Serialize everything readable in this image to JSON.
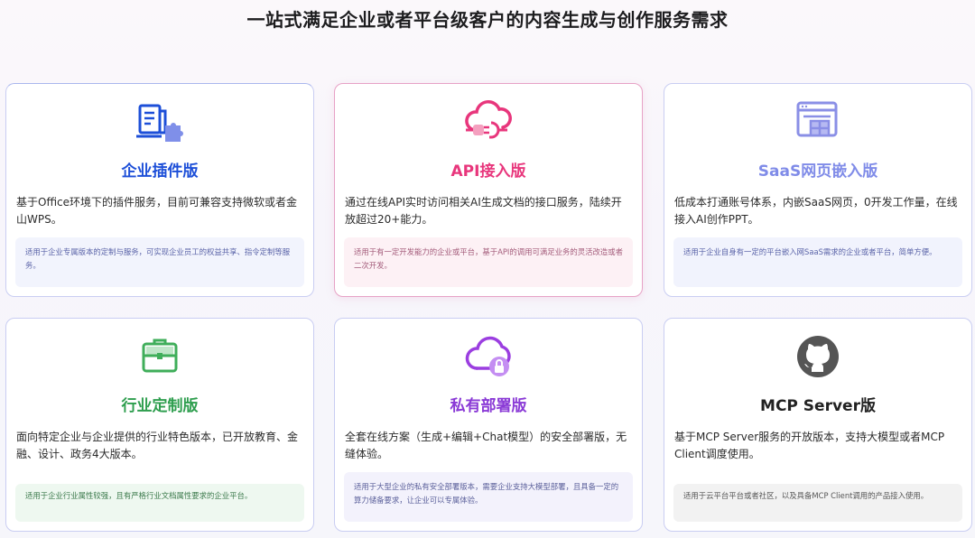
{
  "heading": "一站式满足企业或者平台级客户的内容生成与创作服务需求",
  "cards": [
    {
      "title": "企业插件版",
      "description": "基于Office环境下的插件服务，目前可兼容支持微软或者金山WPS。",
      "note": "适用于企业专属版本的定制与服务，可实现企业员工的权益共享、指令定制等服务。",
      "title_color": "#1d4fd8",
      "icon": "document-puzzle-icon"
    },
    {
      "title": "API接入版",
      "description": "通过在线API实时访问相关AI生成文档的接口服务，陆续开放超过20+能力。",
      "note": "适用于有一定开发能力的企业或平台，基于API的调用可满足业务的灵活改造或者二次开发。",
      "title_color": "#e8367c",
      "icon": "cloud-plug-icon"
    },
    {
      "title": "SaaS网页嵌入版",
      "description": "低成本打通账号体系，内嵌SaaS网页，0开发工作量，在线接入AI创作PPT。",
      "note": "适用于企业自身有一定的平台嵌入网SaaS需求的企业或者平台，简单方便。",
      "title_color": "#7f8be8",
      "icon": "browser-window-icon"
    },
    {
      "title": "行业定制版",
      "description": "面向特定企业与企业提供的行业特色版本，已开放教育、金融、设计、政务4大版本。",
      "note": "适用于企业行业属性较强，且有严格行业文档属性要求的企业平台。",
      "title_color": "#2e9e4e",
      "icon": "briefcase-icon"
    },
    {
      "title": "私有部署版",
      "description": "全套在线方案（生成+编辑+Chat模型）的安全部署版，无缝体验。",
      "note": "适用于大型企业的私有安全部署版本，需要企业支持大模型部署，且具备一定的算力储备要求，让企业可以专属体验。",
      "title_color": "#8a3ad6",
      "icon": "cloud-lock-icon"
    },
    {
      "title": "MCP Server版",
      "description": "基于MCP Server服务的开放版本，支持大模型或者MCP Client调度使用。",
      "note": "适用于云平台平台或者社区，以及具备MCP Client调用的产品接入使用。",
      "title_color": "#222222",
      "icon": "github-icon"
    }
  ]
}
